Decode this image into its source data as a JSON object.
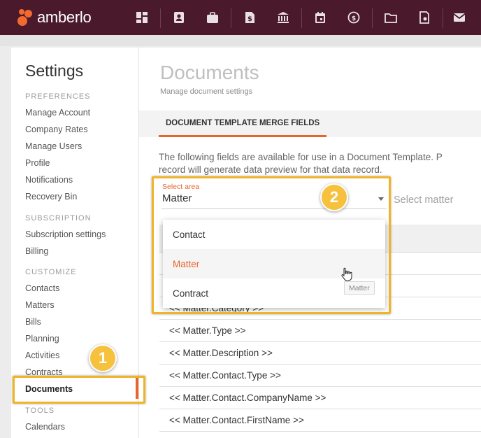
{
  "app": {
    "name": "amberlo"
  },
  "topnav": {
    "icons": [
      "dashboard-icon",
      "contacts-icon",
      "matters-icon",
      "billing-icon",
      "bank-icon",
      "calendar-icon",
      "time-icon",
      "folder-icon",
      "contracts-icon",
      "mail-icon"
    ]
  },
  "sidebar": {
    "title": "Settings",
    "sections": {
      "preferences": "PREFERENCES",
      "subscription": "SUBSCRIPTION",
      "customize": "CUSTOMIZE",
      "tools": "TOOLS"
    },
    "preferences_items": [
      "Manage Account",
      "Company Rates",
      "Manage Users",
      "Profile",
      "Notifications",
      "Recovery Bin"
    ],
    "subscription_items": [
      "Subscription settings",
      "Billing"
    ],
    "customize_items": [
      "Contacts",
      "Matters",
      "Bills",
      "Planning",
      "Activities",
      "Contracts",
      "Documents"
    ],
    "tools_items": [
      "Calendars"
    ],
    "active_item": "Documents"
  },
  "main": {
    "title": "Documents",
    "subtitle": "Manage document settings",
    "tab": "DOCUMENT TEMPLATE MERGE FIELDS",
    "description_line1": "The following fields are available for use in a Document Template. P",
    "description_line2": "record will generate data preview for that data record.",
    "select_area": {
      "label": "Select area",
      "value": "Matter"
    },
    "select_matter": {
      "placeholder": "Select matter"
    },
    "rows": [
      "<< Matter.Category >>",
      "<< Matter.Type >>",
      "<< Matter.Description >>",
      "<< Matter.Contact.Type >>",
      "<< Matter.Contact.CompanyName >>",
      "<< Matter.Contact.FirstName >>"
    ]
  },
  "dropdown": {
    "options": [
      "Contact",
      "Matter",
      "Contract"
    ],
    "selected": "Matter",
    "tooltip": "Matter"
  },
  "callouts": {
    "one": "1",
    "two": "2"
  },
  "colors": {
    "topbar": "#4a1a2c",
    "accent": "#e8652c",
    "callout": "#f6c23e"
  }
}
